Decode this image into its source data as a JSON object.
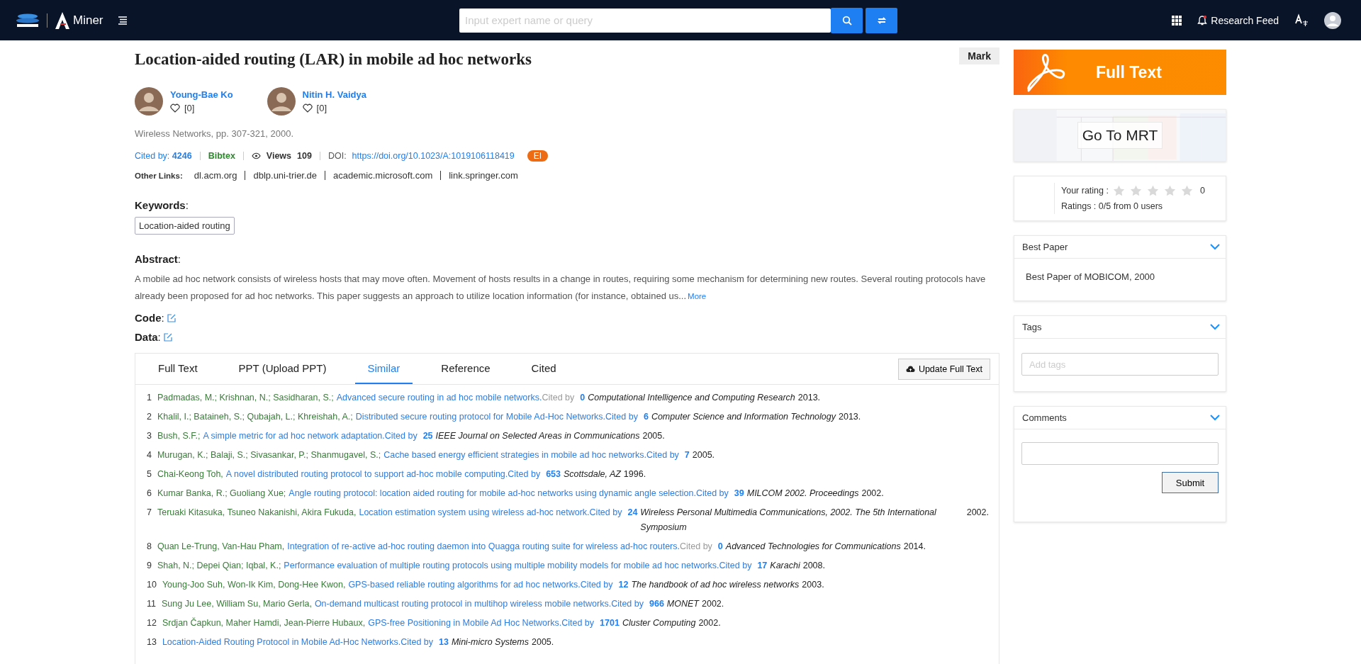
{
  "header": {
    "logo_text": "Miner",
    "search": {
      "placeholder": "Input expert name or query"
    },
    "research_feed": "Research Feed"
  },
  "paper": {
    "title": "Location-aided routing (LAR) in mobile ad hoc networks",
    "mark": "Mark",
    "authors": [
      {
        "name": "Young-Bae Ko",
        "likes": "[0]"
      },
      {
        "name": "Nitin H. Vaidya",
        "likes": "[0]"
      }
    ],
    "venue": "Wireless Networks, pp. 307-321, 2000.",
    "cited_label": "Cited by:",
    "cited_count": "4246",
    "bibtex": "Bibtex",
    "views_label": "Views",
    "views": "109",
    "doi_label": "DOI:",
    "doi": "https://doi.org/10.1023/A:1019106118419",
    "badge": "EI",
    "other_links_label": "Other Links:",
    "other_links": [
      "dl.acm.org",
      "dblp.uni-trier.de",
      "academic.microsoft.com",
      "link.springer.com"
    ],
    "keywords_label": "**Keywords**:",
    "keywords": [
      "Location-aided routing"
    ],
    "abstract_label": "**Abstract**:",
    "abstract": "A mobile ad hoc network consists of wireless hosts that may move often. Movement of hosts results in a change in routes, requiring some mechanism for determining new routes. Several routing protocols have already been proposed for ad hoc networks. This paper suggests an approach to utilize location information (for instance, obtained us...",
    "more": "More",
    "code_label": "**Code**:",
    "data_label": "**Data**:"
  },
  "tabs": [
    {
      "label": "Full Text",
      "selected": false
    },
    {
      "label": "PPT (Upload PPT)",
      "selected": false
    },
    {
      "label": "Similar",
      "selected": true
    },
    {
      "label": "Reference",
      "selected": false
    },
    {
      "label": "Cited",
      "selected": false
    }
  ],
  "update_button": "Update Full Text",
  "references": [
    {
      "num": "1",
      "authors": "Padmadas, M.; Krishnan, N.; Sasidharan, S.;",
      "title": "Advanced secure routing in ad hoc mobile networks.",
      "cited_by": "Cited by",
      "muted": true,
      "count": "0",
      "venue": "Computational Intelligence and Computing Research",
      "year": "2013."
    },
    {
      "num": "2",
      "authors": "Khalil, I.; Bataineh, S.; Qubajah, L.; Khreishah, A.;",
      "title": "Distributed secure routing protocol for Mobile Ad-Hoc Networks.",
      "cited_by": "Cited by",
      "muted": false,
      "count": "6",
      "venue": "Computer Science and Information Technology",
      "year": "2013."
    },
    {
      "num": "3",
      "authors": "Bush, S.F.;",
      "title": "A simple metric for ad hoc network adaptation.",
      "cited_by": "Cited by",
      "muted": false,
      "count": "25",
      "venue": "IEEE Journal on Selected Areas in Communications",
      "year": "2005."
    },
    {
      "num": "4",
      "authors": "Murugan, K.; Balaji, S.; Sivasankar, P.; Shanmugavel, S.;",
      "title": "Cache based energy efficient strategies in mobile ad hoc networks.",
      "cited_by": "Cited by",
      "muted": false,
      "count": "7",
      "year": "2005."
    },
    {
      "num": "5",
      "authors": "Chai-Keong Toh,",
      "title": "A novel distributed routing protocol to support ad-hoc mobile computing.",
      "cited_by": "Cited by",
      "muted": false,
      "count": "653",
      "venue": "Scottsdale, AZ",
      "year": "1996."
    },
    {
      "num": "6",
      "authors": "Kumar Banka, R.; Guoliang Xue;",
      "title": "Angle routing protocol: location aided routing for mobile ad-hoc networks using dynamic angle selection.",
      "cited_by": "Cited by",
      "muted": false,
      "count": "39",
      "venue": "MILCOM 2002. Proceedings",
      "year": "2002."
    },
    {
      "num": "7",
      "authors": "Teruaki Kitasuka, Tsuneo Nakanishi, Akira Fukuda,",
      "title": "Location estimation system using wireless ad-hoc network.",
      "cited_by": "Cited by",
      "muted": false,
      "count": "24",
      "venue": "Wireless Personal Multimedia Communications, 2002. The 5th International Symposium",
      "year": "2002."
    },
    {
      "num": "8",
      "authors": "Quan Le-Trung, Van-Hau Pham,",
      "title": "Integration of re-active ad-hoc routing daemon into Quagga routing suite for wireless ad-hoc routers.",
      "cited_by": "Cited by",
      "muted": true,
      "count": "0",
      "venue": "Advanced Technologies for Communications",
      "year": "2014."
    },
    {
      "num": "9",
      "authors": "Shah, N.; Depei Qian; Iqbal, K.;",
      "title": "Performance evaluation of multiple routing protocols using multiple mobility models for mobile ad hoc networks.",
      "cited_by": "Cited by",
      "muted": false,
      "count": "17",
      "venue": "Karachi",
      "year": "2008."
    },
    {
      "num": "10",
      "authors": "Young-Joo Suh, Won-Ik Kim, Dong-Hee Kwon,",
      "title": "GPS-based reliable routing algorithms for ad hoc networks.",
      "cited_by": "Cited by",
      "muted": false,
      "count": "12",
      "venue": "The handbook of ad hoc wireless networks",
      "year": "2003."
    },
    {
      "num": "11",
      "authors": "Sung Ju Lee, William Su, Mario Gerla,",
      "title": "On-demand multicast routing protocol in multihop wireless mobile networks.",
      "cited_by": "Cited by",
      "muted": false,
      "count": "966",
      "venue": "MONET",
      "year": "2002."
    },
    {
      "num": "12",
      "authors": "Srdjan Čapkun, Maher Hamdi, Jean-Pierre Hubaux,",
      "title": "GPS-free Positioning in Mobile Ad Hoc Networks.",
      "cited_by": "Cited by",
      "muted": false,
      "count": "1701",
      "venue": "Cluster Computing",
      "year": "2002."
    },
    {
      "num": "13",
      "title": "Location-Aided Routing Protocol in Mobile Ad-Hoc Networks.",
      "cited_by": "Cited by",
      "muted": false,
      "count": "13",
      "venue": "Mini-micro Systems",
      "year": "2005."
    }
  ],
  "sidebar": {
    "full_text": "Full Text",
    "mrt": "Go To MRT",
    "rating": {
      "label": "Your rating :",
      "stars": 0,
      "value": "0",
      "summary": "Ratings : 0/5 from 0 users"
    },
    "best_paper": {
      "title": "Best Paper",
      "text": "Best Paper of MOBICOM, 2000"
    },
    "tags": {
      "title": "Tags",
      "placeholder": "Add tags"
    },
    "comments": {
      "title": "Comments",
      "submit": "Submit"
    }
  }
}
